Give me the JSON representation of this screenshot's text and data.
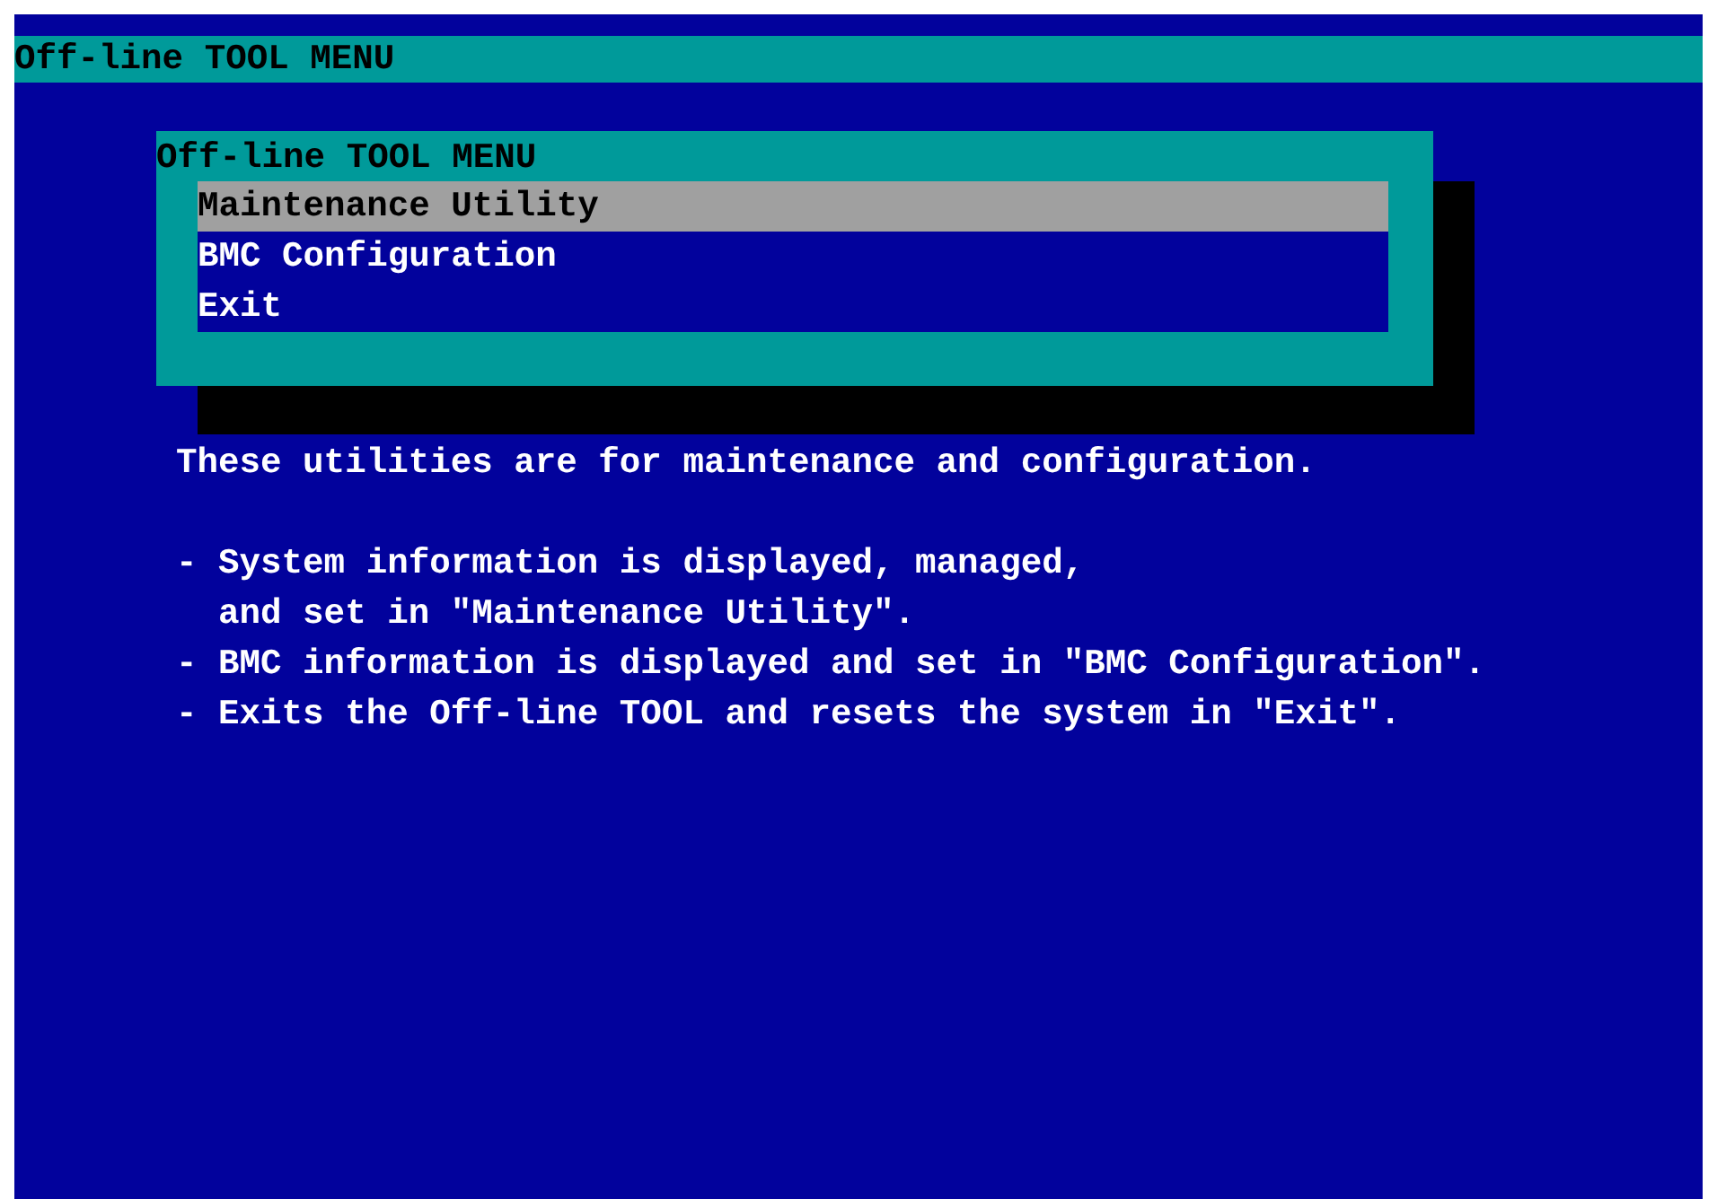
{
  "title_bar": {
    "title": "Off-line TOOL MENU"
  },
  "menu": {
    "title": "Off-line TOOL MENU",
    "items": [
      {
        "label": "Maintenance Utility",
        "selected": true
      },
      {
        "label": "BMC Configuration",
        "selected": false
      },
      {
        "label": "Exit",
        "selected": false
      }
    ]
  },
  "description": {
    "intro": "These utilities are for maintenance and configuration.",
    "lines": [
      "- System information is displayed, managed,",
      "  and set in \"Maintenance Utility\".",
      "- BMC information is displayed and set in \"BMC Configuration\".",
      "- Exits the Off-line TOOL and resets the system in \"Exit\"."
    ]
  }
}
